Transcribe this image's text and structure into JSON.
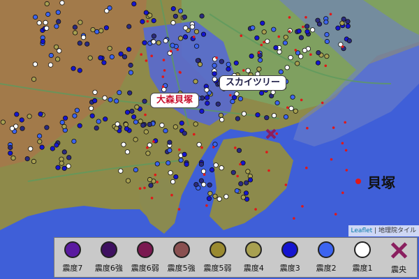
{
  "map": {
    "callouts": {
      "skytree": "スカイツリー",
      "omori": "大森貝塚"
    },
    "side_label": "貝塚",
    "attribution": {
      "leaflet": "Leaflet",
      "separator": "|",
      "source": "地理院タイル"
    }
  },
  "legend": {
    "items": [
      {
        "label": "震度7",
        "color": "#5a1aa0"
      },
      {
        "label": "震度6強",
        "color": "#3e1060"
      },
      {
        "label": "震度6弱",
        "color": "#7a1850"
      },
      {
        "label": "震度5強",
        "color": "#8a5050"
      },
      {
        "label": "震度5弱",
        "color": "#9a8a30"
      },
      {
        "label": "震度4",
        "color": "#a8a050"
      },
      {
        "label": "震度3",
        "color": "#1414d0"
      },
      {
        "label": "震度2",
        "color": "#3c64f0"
      },
      {
        "label": "震度1",
        "color": "#ffffff"
      },
      {
        "label": "震央",
        "color": "#8a1f5f",
        "icon": "cross-icon"
      }
    ]
  }
}
